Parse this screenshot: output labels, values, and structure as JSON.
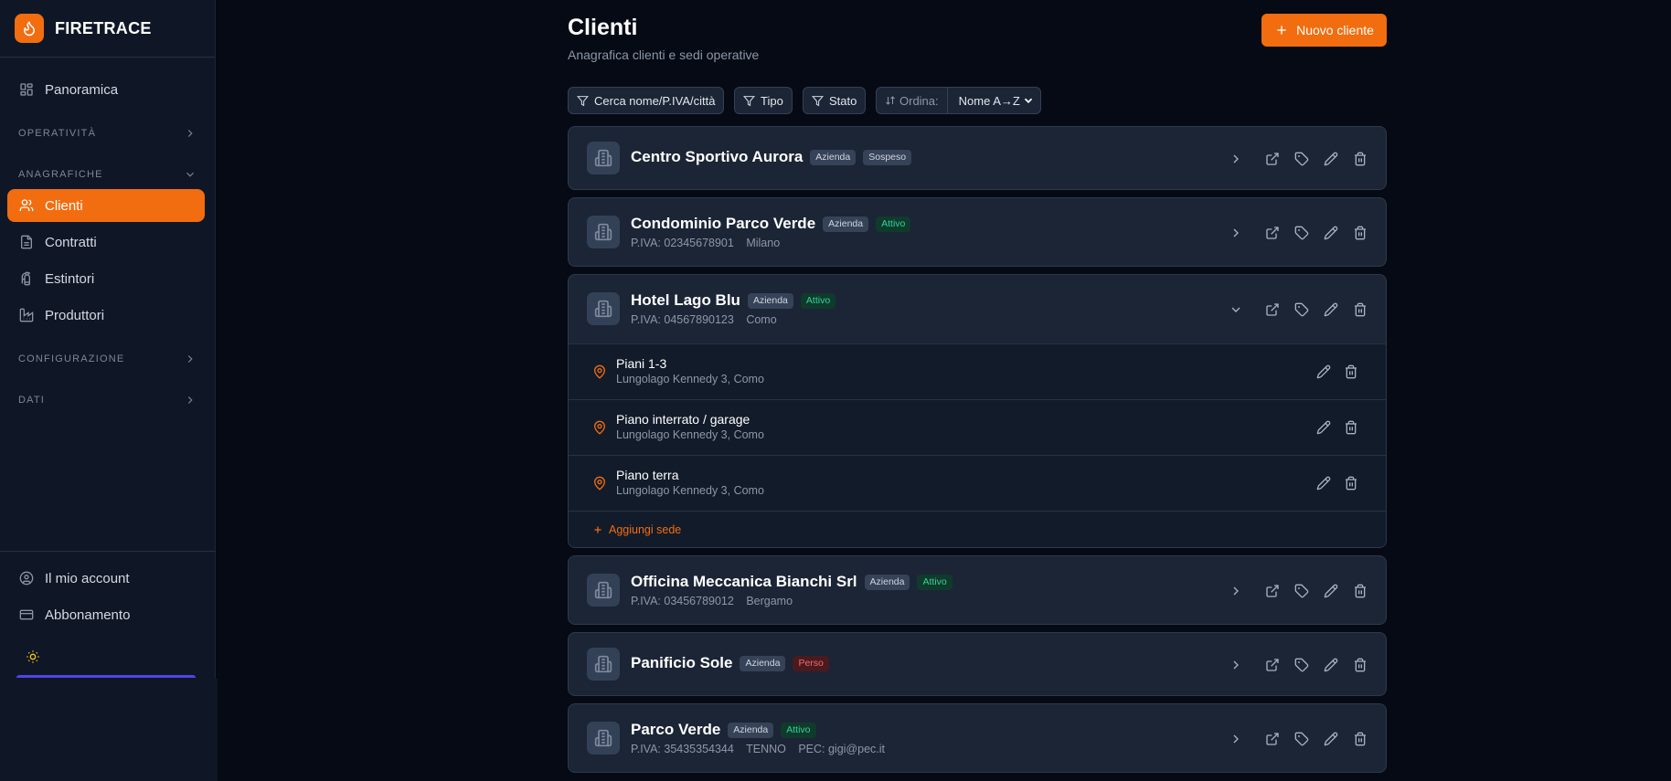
{
  "brand": {
    "name": "FIRETRACE",
    "accent": "#f26d0f",
    "logo_icon": "flame-icon"
  },
  "sidebar": {
    "overview": {
      "label": "Panoramica",
      "icon": "grid-icon"
    },
    "sections": {
      "operativita": "OPERATIVITÀ",
      "anagrafiche": "ANAGRAFICHE",
      "configurazione": "CONFIGURAZIONE",
      "dati": "DATI"
    },
    "items": [
      {
        "label": "Clienti",
        "icon": "users-icon",
        "active": true
      },
      {
        "label": "Contratti",
        "icon": "document-icon",
        "active": false
      },
      {
        "label": "Estintori",
        "icon": "extinguisher-icon",
        "active": false
      },
      {
        "label": "Produttori",
        "icon": "factory-icon",
        "active": false
      }
    ],
    "footer": {
      "account": {
        "label": "Il mio account",
        "icon": "user-circle-icon"
      },
      "subscription": {
        "label": "Abbonamento",
        "icon": "credit-card-icon"
      },
      "theme_icon": "sun-icon"
    }
  },
  "header": {
    "title": "Clienti",
    "subtitle": "Anagrafica clienti e sedi operative",
    "new_button": "Nuovo cliente"
  },
  "filters": {
    "search": "Cerca nome/P.IVA/città",
    "type": "Tipo",
    "status": "Stato",
    "sort_label": "Ordina:",
    "sort_value": "Nome A→Z"
  },
  "clients": [
    {
      "name": "Centro Sportivo Aurora",
      "type": "Azienda",
      "status": "Sospeso",
      "piva": "",
      "city": "",
      "pec": ""
    },
    {
      "name": "Condominio Parco Verde",
      "type": "Azienda",
      "status": "Attivo",
      "piva": "P.IVA: 02345678901",
      "city": "Milano",
      "pec": ""
    },
    {
      "name": "Hotel Lago Blu",
      "type": "Azienda",
      "status": "Attivo",
      "piva": "P.IVA: 04567890123",
      "city": "Como",
      "pec": "",
      "expanded": true
    },
    {
      "name": "Officina Meccanica Bianchi Srl",
      "type": "Azienda",
      "status": "Attivo",
      "piva": "P.IVA: 03456789012",
      "city": "Bergamo",
      "pec": ""
    },
    {
      "name": "Panificio Sole",
      "type": "Azienda",
      "status": "Perso",
      "piva": "",
      "city": "",
      "pec": ""
    },
    {
      "name": "Parco Verde",
      "type": "Azienda",
      "status": "Attivo",
      "piva": "P.IVA: 35435354344",
      "city": "TENNO",
      "pec": "PEC: gigi@pec.it"
    }
  ],
  "sedi": [
    {
      "name": "Piani 1-3",
      "address": "Lungolago Kennedy 3, Como"
    },
    {
      "name": "Piano interrato / garage",
      "address": "Lungolago Kennedy 3, Como"
    },
    {
      "name": "Piano terra",
      "address": "Lungolago Kennedy 3, Como"
    }
  ],
  "add_sede": "Aggiungi sede",
  "colors": {
    "active": "#34d399",
    "lost": "#f26b6b",
    "background": "#050a14",
    "card": "#1b2535"
  }
}
